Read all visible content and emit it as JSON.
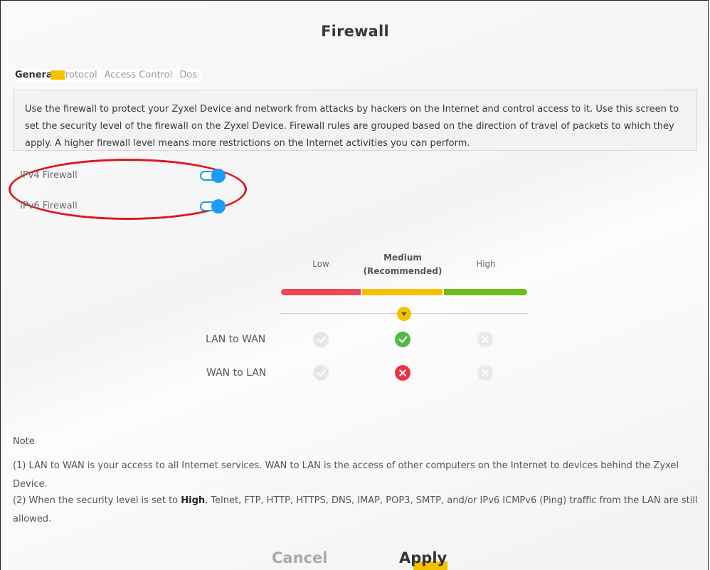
{
  "page": {
    "title": "Firewall"
  },
  "tabs": [
    {
      "label": "General",
      "active": true
    },
    {
      "label": "Protocol",
      "active": false
    },
    {
      "label": "Access Control",
      "active": false
    },
    {
      "label": "Dos",
      "active": false
    }
  ],
  "description": "Use the firewall to protect your Zyxel Device and network from attacks by hackers on the Internet and control access to it. Use this screen to set the security level of the firewall on the Zyxel Device. Firewall rules are grouped based on the direction of travel of packets to which they apply. A higher firewall level means more restrictions on the Internet activities you can perform.",
  "firewalls": {
    "ipv4": {
      "label": "IPv4 Firewall",
      "enabled": true
    },
    "ipv6": {
      "label": "IPv6 Firewall",
      "enabled": true
    }
  },
  "levels": {
    "low": "Low",
    "medium_line1": "Medium",
    "medium_line2": "(Recommended)",
    "high": "High",
    "selected": "Medium"
  },
  "directions": [
    {
      "label": "LAN to WAN",
      "low": "allowed",
      "medium": "allowed",
      "high": "blocked"
    },
    {
      "label": "WAN to LAN",
      "low": "allowed",
      "medium": "blocked",
      "high": "blocked"
    }
  ],
  "notes": {
    "title": "Note",
    "note1": "(1) LAN to WAN is your access to all Internet services. WAN to LAN is the access of other computers on the Internet to devices behind the Zyxel Device.",
    "note2_prefix": "(2) When the security level is set to ",
    "note2_bold": "High",
    "note2_suffix": ", Telnet, FTP, HTTP, HTTPS, DNS, IMAP, POP3, SMTP, and/or IPv6 ICMPv6 (Ping) traffic from the LAN are still allowed."
  },
  "buttons": {
    "cancel": "Cancel",
    "apply": "Apply"
  },
  "colors": {
    "accent": "#f5c000",
    "toggle": "#1a9cf0",
    "low": "#e84a55",
    "medium": "#f5c000",
    "high": "#6cbe1d",
    "highlight_ellipse": "#e0151e"
  }
}
